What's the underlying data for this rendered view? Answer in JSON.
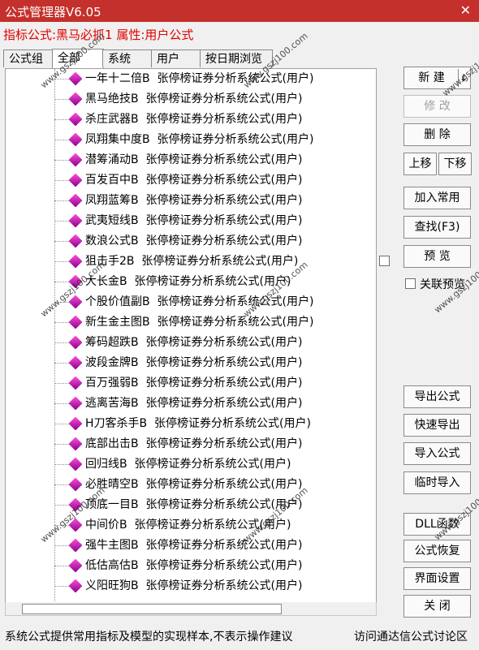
{
  "window": {
    "title": "公式管理器V6.05"
  },
  "info": {
    "text": "指标公式:黑马必抓1  属性:用户公式"
  },
  "tabs": [
    {
      "label": "公式组"
    },
    {
      "label": "全部"
    },
    {
      "label": "系统"
    },
    {
      "label": "用户"
    },
    {
      "label": "按日期浏览"
    }
  ],
  "tree": {
    "suffix": "张停榜证券分析系统公式(用户)",
    "items": [
      {
        "name": "一年十二倍B"
      },
      {
        "name": "黑马绝技B"
      },
      {
        "name": "杀庄武器B"
      },
      {
        "name": "凤翔集中度B"
      },
      {
        "name": "潜筹涌动B"
      },
      {
        "name": "百发百中B"
      },
      {
        "name": "凤翔蓝筹B"
      },
      {
        "name": "武夷短线B"
      },
      {
        "name": "数浪公式B"
      },
      {
        "name": "狙击手2B"
      },
      {
        "name": "大长金B"
      },
      {
        "name": "个股价值副B"
      },
      {
        "name": "新生金主图B"
      },
      {
        "name": "筹码超跌B"
      },
      {
        "name": "波段金牌B"
      },
      {
        "name": "百万强弱B"
      },
      {
        "name": "逃离苦海B"
      },
      {
        "name": "H刀客杀手B"
      },
      {
        "name": "底部出击B"
      },
      {
        "name": "回归线B"
      },
      {
        "name": "必胜晴空B"
      },
      {
        "name": "顶底一目B"
      },
      {
        "name": "中间价B"
      },
      {
        "name": "强牛主图B"
      },
      {
        "name": "低估高估B"
      },
      {
        "name": "义阳旺狗B"
      }
    ]
  },
  "buttons": {
    "new": "新 建",
    "modify": "修 改",
    "delete": "删 除",
    "move_up": "上移",
    "move_down": "下移",
    "add_common": "加入常用",
    "find": "查找(F3)",
    "preview": "预 览",
    "link_checkbox": "关联预览",
    "export": "导出公式",
    "quick_export": "快速导出",
    "import": "导入公式",
    "temp_import": "临时导入",
    "dll": "DLL函数",
    "restore": "公式恢复",
    "ui_settings": "界面设置",
    "close": "关 闭"
  },
  "status": {
    "left": "系统公式提供常用指标及模型的实现样本,不表示操作建议",
    "right": "访问通达信公式讨论区"
  },
  "watermarks": {
    "text": "公式之家",
    "url": "www.gszj100.com"
  }
}
